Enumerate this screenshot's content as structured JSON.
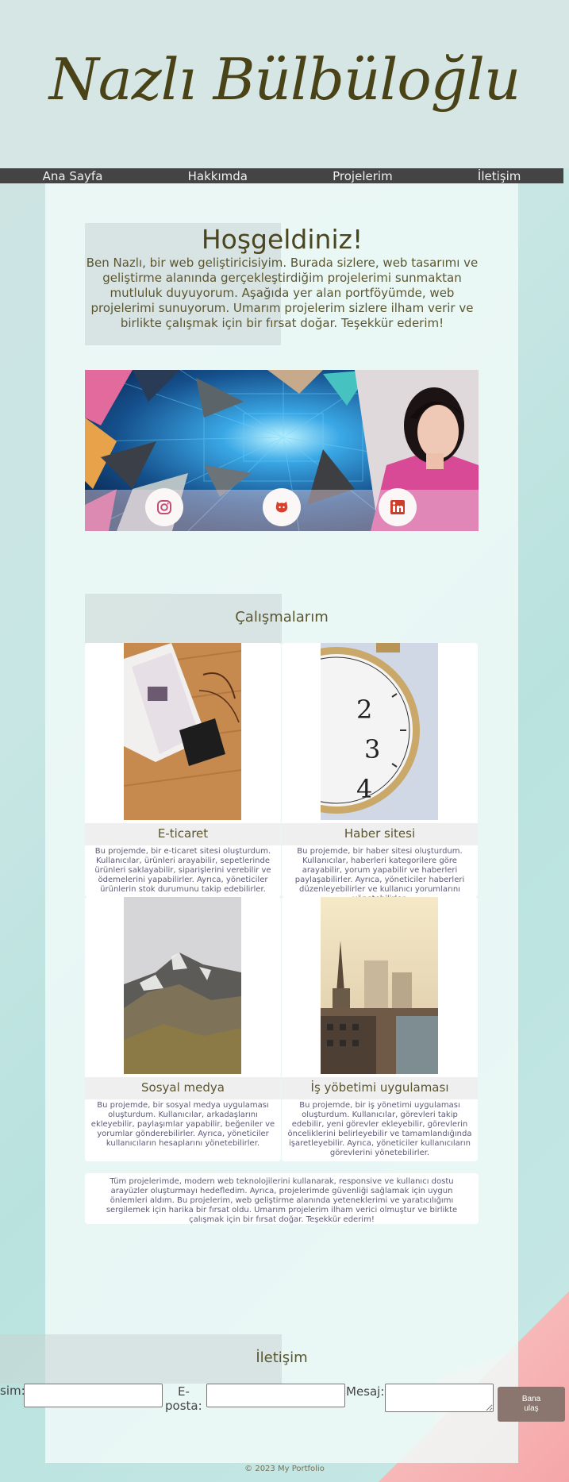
{
  "brand": {
    "name": "Nazlı Bülbüloğlu"
  },
  "nav": {
    "items": [
      "Ana Sayfa",
      "Hakkımda",
      "Projelerim",
      "İletişim"
    ]
  },
  "welcome": {
    "title": "Hoşgeldiniz!",
    "text": "Ben Nazlı, bir web geliştiricisiyim. Burada sizlere, web tasarımı ve geliştirme alanında gerçekleştirdiğim projelerimi sunmaktan mutluluk duyuyorum. Aşağıda yer alan portföyümde, web projelerimi sunuyorum. Umarım projelerim sizlere ilham verir ve birlikte çalışmak için bir fırsat doğar. Teşekkür ederim!"
  },
  "social": {
    "icons": [
      "instagram-icon",
      "github-icon",
      "linkedin-icon"
    ]
  },
  "works": {
    "title": "Çalışmalarım",
    "projects": [
      {
        "title": "E-ticaret",
        "desc": "Bu projemde, bir e-ticaret sitesi oluşturdum. Kullanıcılar, ürünleri arayabilir, sepetlerinde ürünleri saklayabilir, siparişlerini verebilir ve ödemelerini yapabilirler. Ayrıca, yöneticiler ürünlerin stok durumunu takip edebilirler."
      },
      {
        "title": "Haber sitesi",
        "desc": "Bu projemde, bir haber sitesi oluşturdum. Kullanıcılar, haberleri kategorilere göre arayabilir, yorum yapabilir ve haberleri paylaşabilirler. Ayrıca, yöneticiler haberleri düzenleyebilirler ve kullanıcı yorumlarını yönetebilirler."
      },
      {
        "title": "Sosyal medya",
        "desc": "Bu projemde, bir sosyal medya uygulaması oluşturdum. Kullanıcılar, arkadaşlarını ekleyebilir, paylaşımlar yapabilir, beğeniler ve yorumlar gönderebilirler. Ayrıca, yöneticiler kullanıcıların hesaplarını yönetebilirler."
      },
      {
        "title": "İş yöbetimi uygulaması",
        "desc": "Bu projemde, bir iş yönetimi uygulaması oluşturdum. Kullanıcılar, görevleri takip edebilir, yeni görevler ekleyebilir, görevlerin önceliklerini belirleyebilir ve tamamlandığında işaretleyebilir. Ayrıca, yöneticiler kullanıcıların görevlerini yönetebilirler."
      }
    ],
    "summary": "Tüm projelerimde, modern web teknolojilerini kullanarak, responsive ve kullanıcı dostu arayüzler oluşturmayı hedefledim. Ayrıca, projelerimde güvenliği sağlamak için uygun önlemleri aldım. Bu projelerim, web geliştirme alanında yeteneklerimi ve yaratıcılığımı sergilemek için harika bir fırsat oldu. Umarım projelerim ilham verici olmuştur ve birlikte çalışmak için bir fırsat doğar. Teşekkür ederim!"
  },
  "contact": {
    "title": "İletişim",
    "name_label": "sim:",
    "email_label_1": "E-",
    "email_label_2": "posta:",
    "message_label": "Mesaj:",
    "name_value": "",
    "email_value": "",
    "message_value": "",
    "button_line1": "Bana",
    "button_line2": "ulaş"
  },
  "footer": {
    "text": "© 2023 My Portfolio"
  },
  "colors": {
    "nav_bg": "#444444",
    "heading": "#4b4520",
    "button": "#8a766e"
  }
}
